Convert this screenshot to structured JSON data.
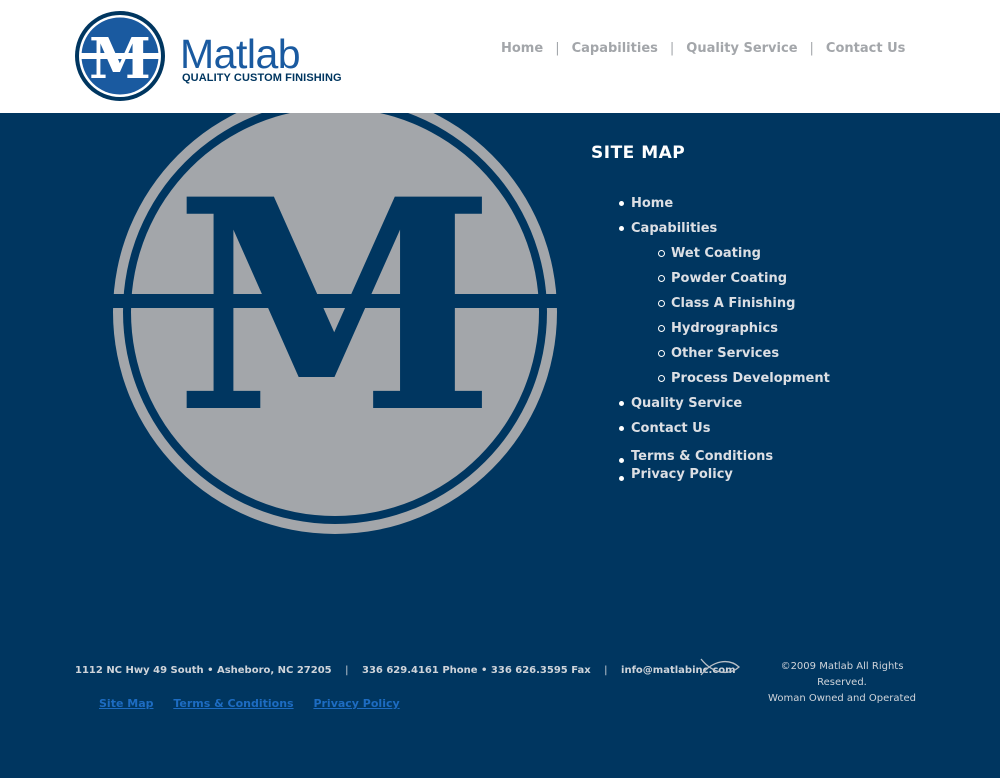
{
  "header": {
    "logo": {
      "letter": "M",
      "name": "Matlab",
      "tagline": "QUALITY CUSTOM FINISHING"
    },
    "nav": [
      {
        "label": "Home"
      },
      {
        "label": "Capabilities"
      },
      {
        "label": "Quality Service"
      },
      {
        "label": "Contact Us"
      }
    ],
    "nav_separator": "|"
  },
  "hero": {
    "letter": "M"
  },
  "sitemap": {
    "title": "SITE MAP",
    "items": [
      {
        "label": "Home"
      },
      {
        "label": "Capabilities",
        "children": [
          {
            "label": "Wet Coating"
          },
          {
            "label": "Powder Coating"
          },
          {
            "label": "Class A Finishing"
          },
          {
            "label": "Hydrographics"
          },
          {
            "label": "Other Services"
          },
          {
            "label": "Process Development"
          }
        ]
      },
      {
        "label": "Quality Service"
      },
      {
        "label": "Contact Us"
      }
    ],
    "legal": [
      {
        "label": "Terms & Conditions"
      },
      {
        "label": "Privacy Policy"
      }
    ]
  },
  "footer": {
    "address": "1112 NC Hwy 49 South • Asheboro, NC 27205",
    "phones": "336 629.4161 Phone • 336 626.3595 Fax",
    "email": "info@matlabinc.com",
    "separator": "|",
    "links": [
      {
        "label": "Site Map"
      },
      {
        "label": "Terms & Conditions"
      },
      {
        "label": "Privacy Policy"
      }
    ],
    "copyright": "©2009 Matlab All Rights Reserved.",
    "ownership": "Woman Owned and Operated",
    "icon": "ichthys-fish-icon"
  },
  "colors": {
    "navy": "#003660",
    "brand_blue": "#1a5aa0",
    "hero_gray": "#a3a6aa",
    "link_blue": "#1d6cc2"
  }
}
